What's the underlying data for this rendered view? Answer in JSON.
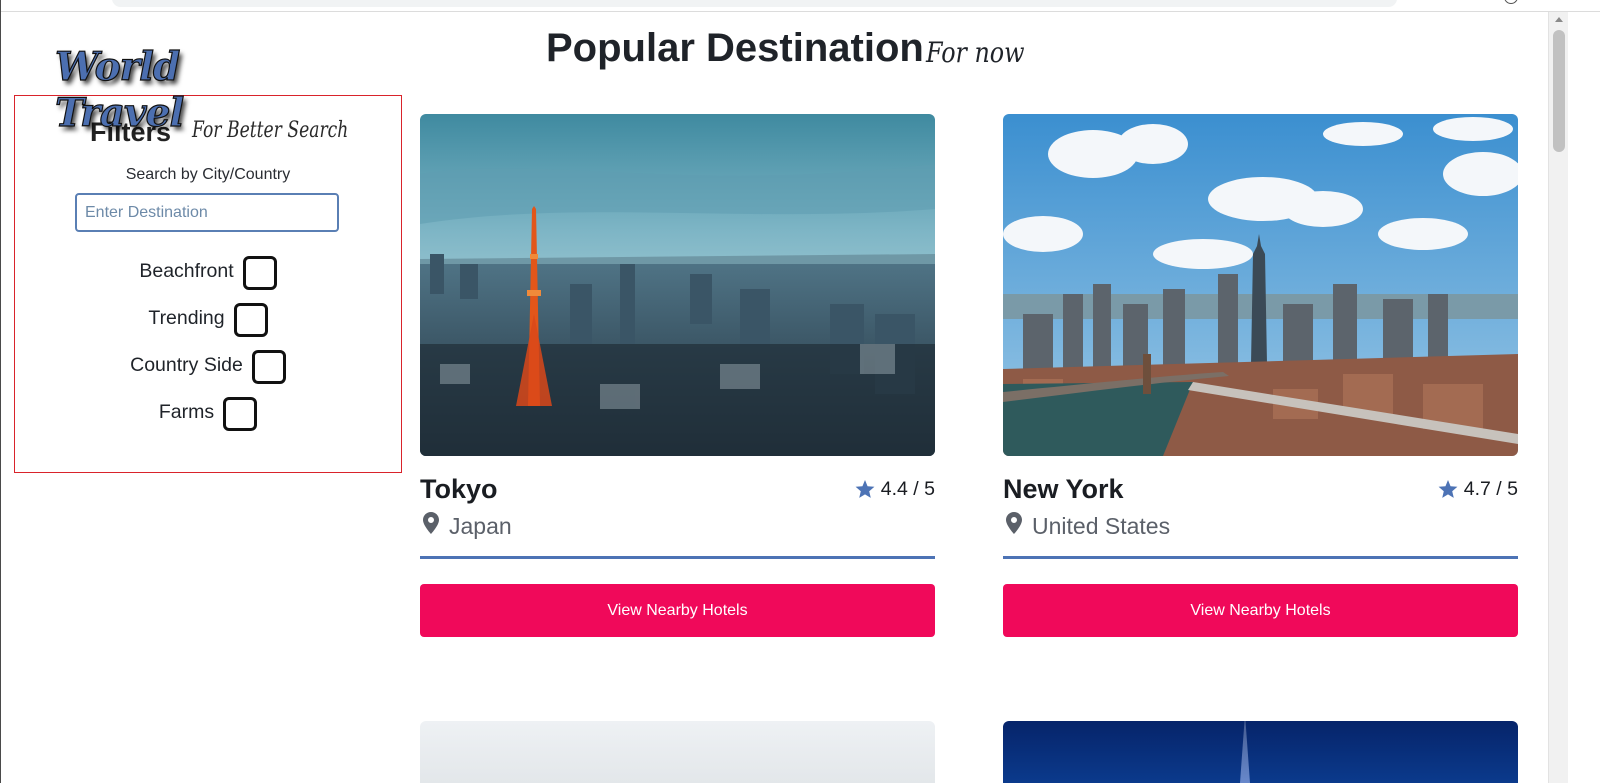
{
  "logo": {
    "line1": "World",
    "line2": "Travel"
  },
  "filters": {
    "heading": "Filters",
    "subheading": "For Better Search",
    "search_label": "Search by City/Country",
    "search_placeholder": "Enter Destination",
    "search_value": "",
    "options": [
      {
        "label": "Beachfront",
        "checked": false
      },
      {
        "label": "Trending",
        "checked": false
      },
      {
        "label": "Country Side",
        "checked": false
      },
      {
        "label": "Farms",
        "checked": false
      }
    ]
  },
  "page": {
    "title": "Popular Destination",
    "subtitle": "For now"
  },
  "destinations": [
    {
      "city": "Tokyo",
      "country": "Japan",
      "rating": "4.4 / 5",
      "button_label": "View Nearby Hotels",
      "image": "tokyo-skyline-photo"
    },
    {
      "city": "New York",
      "country": "United States",
      "rating": "4.7 / 5",
      "button_label": "View Nearby Hotels",
      "image": "new-york-skyline-photo"
    }
  ],
  "colors": {
    "accent": "#4d73b5",
    "button": "#f0095a",
    "panel_border": "#d9232b"
  },
  "icons": {
    "rating": "star-icon",
    "location": "map-pin-icon"
  }
}
